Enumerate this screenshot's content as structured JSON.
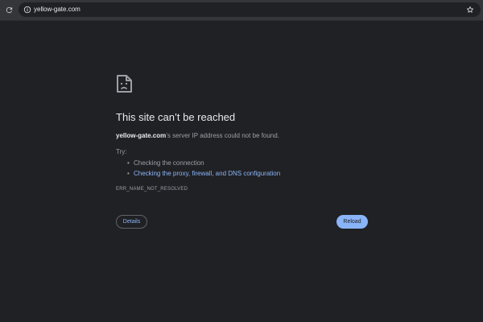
{
  "browser": {
    "url": "yellow-gate.com",
    "icons": {
      "reload": "reload-icon",
      "site_info": "info-icon",
      "bookmark": "star-icon"
    }
  },
  "error_page": {
    "icon": "sad-document-icon",
    "title": "This site can’t be reached",
    "message_host": "yellow-gate.com",
    "message_rest": "’s server IP address could not be found.",
    "try_label": "Try:",
    "suggestions": [
      {
        "text": "Checking the connection",
        "is_link": false
      },
      {
        "text": "Checking the proxy, firewall, and DNS configuration",
        "is_link": true
      }
    ],
    "error_code": "ERR_NAME_NOT_RESOLVED",
    "details_label": "Details",
    "reload_label": "Reload"
  },
  "colors": {
    "background": "#202124",
    "toolbar": "#35363a",
    "link": "#8ab4f8",
    "text_primary": "#e8eaed",
    "text_secondary": "#9aa0a6"
  }
}
